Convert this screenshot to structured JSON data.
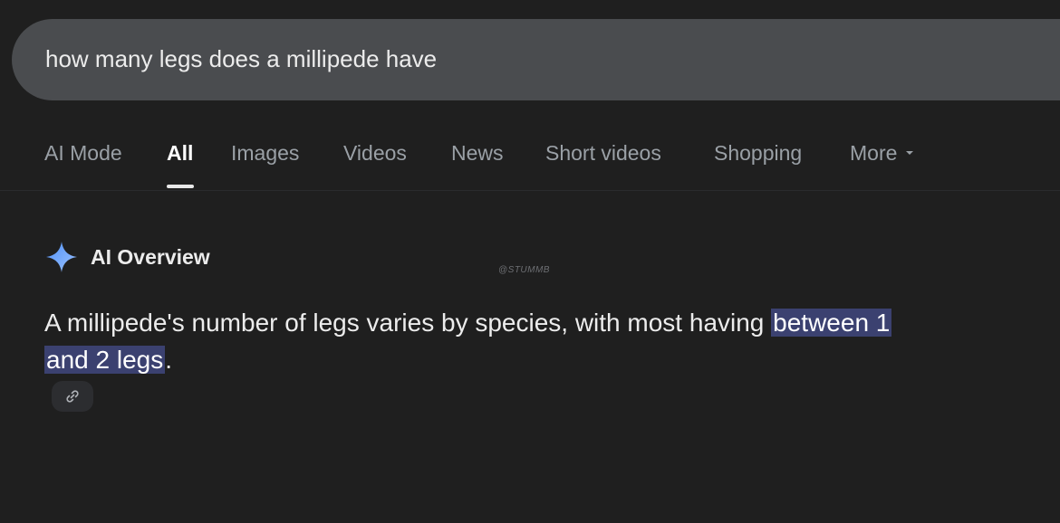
{
  "search": {
    "query": "how many legs does a millipede have"
  },
  "tabs": [
    {
      "label": "AI Mode"
    },
    {
      "label": "All"
    },
    {
      "label": "Images"
    },
    {
      "label": "Videos"
    },
    {
      "label": "News"
    },
    {
      "label": "Short videos"
    },
    {
      "label": "Shopping"
    },
    {
      "label": "More"
    }
  ],
  "ai_overview": {
    "title": "AI Overview",
    "watermark": "@STUMMB",
    "answer_part1": "A millipede's number of legs varies by species, with most having ",
    "answer_highlight_line1": "between 1",
    "answer_highlight_line2": "and 2 legs",
    "answer_end": ".",
    "icon": "sparkle-icon",
    "source_icon": "link-icon"
  },
  "colors": {
    "background": "#1f1f1f",
    "search_bar": "#4a4c4f",
    "highlight": "#3b4170",
    "sparkle": "#78a7f5"
  }
}
